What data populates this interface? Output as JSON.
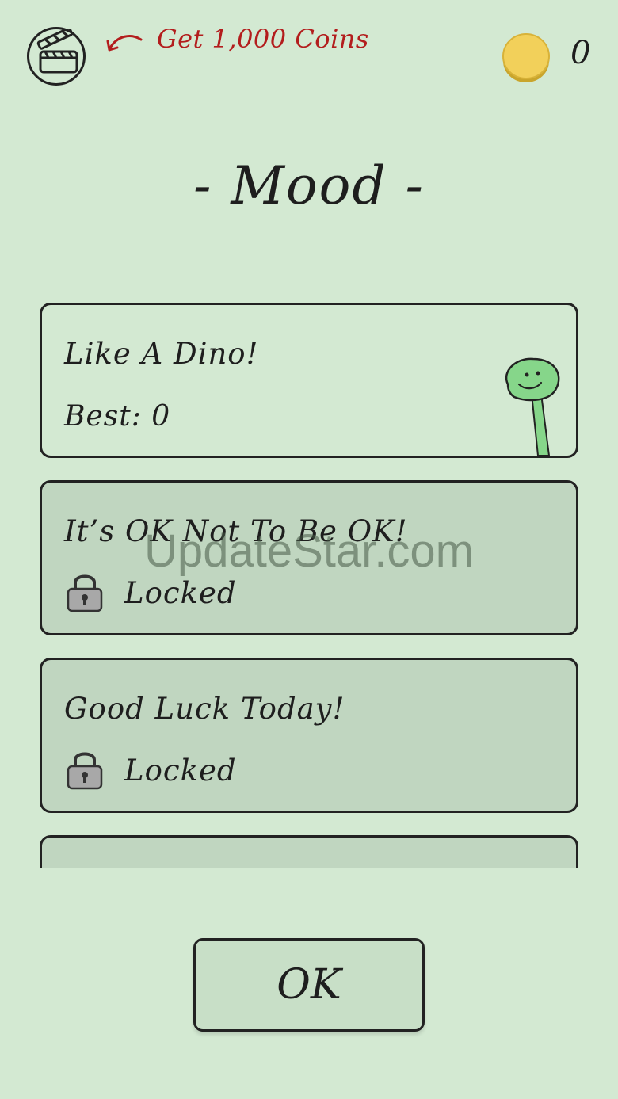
{
  "header": {
    "promo_text": "Get 1,000 Coins",
    "coins": "0"
  },
  "title": "- Mood -",
  "levels": [
    {
      "name": "Like A Dino!",
      "best": "Best: 0",
      "status": "unlocked"
    },
    {
      "name": "It’s OK Not To Be OK!",
      "locked_label": "Locked",
      "status": "locked"
    },
    {
      "name": "Good Luck Today!",
      "locked_label": "Locked",
      "status": "locked"
    }
  ],
  "ok_label": "OK",
  "watermark": "UpdateStar.com",
  "icons": {
    "video": "clapperboard-icon",
    "arrow": "curved-arrow-icon",
    "coin": "coin-icon",
    "lock": "padlock-icon",
    "character": "dino-icon"
  },
  "colors": {
    "background": "#d3e9d2",
    "locked_card": "#c0d6c0",
    "promo": "#b31d1d",
    "coin": "#f2d05a",
    "dino": "#86d68a"
  }
}
